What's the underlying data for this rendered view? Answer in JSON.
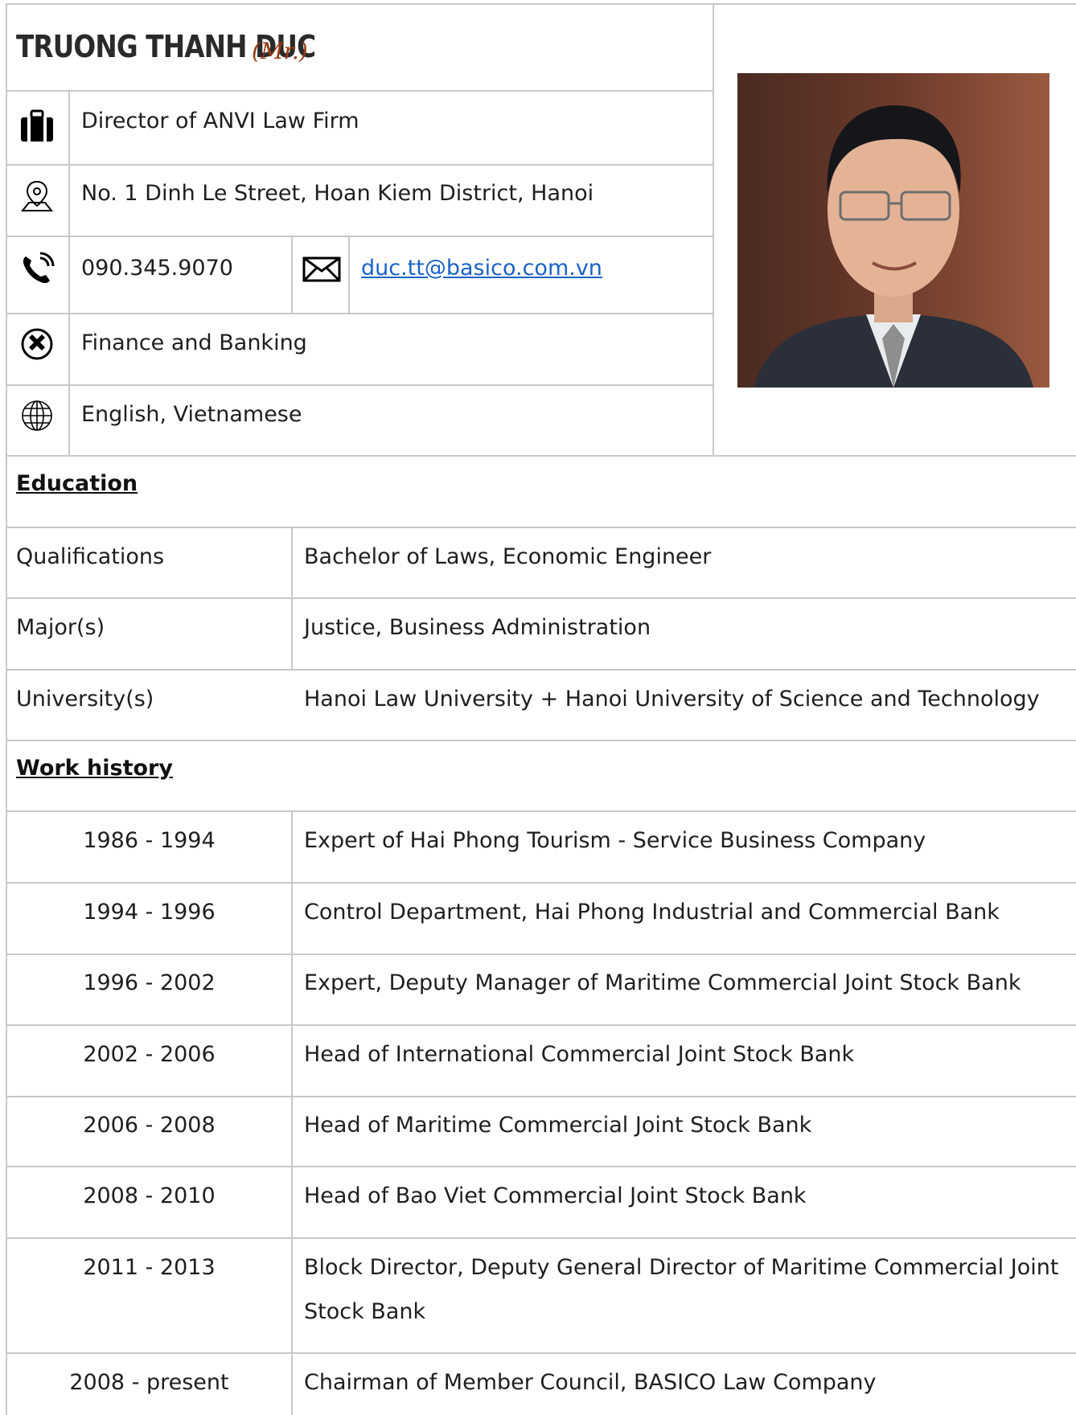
{
  "profile": {
    "name": "TRUONG THANH DUC",
    "title_suffix": "(Mr.)",
    "position": "Director of ANVI Law Firm",
    "address": "No. 1 Dinh Le Street, Hoan Kiem District, Hanoi",
    "phone": "090.345.9070",
    "email": "duc.tt@basico.com.vn",
    "field": "Finance and Banking",
    "languages": "English, Vietnamese",
    "icons": {
      "position": "briefcase-icon",
      "address": "location-pin-icon",
      "phone": "phone-icon",
      "email": "envelope-icon",
      "field": "expertise-icon",
      "languages": "globe-icon"
    }
  },
  "education": {
    "heading": "Education",
    "rows": [
      {
        "label": "Qualifications",
        "value": "Bachelor of Laws, Economic Engineer"
      },
      {
        "label": "Major(s)",
        "value": "Justice, Business Administration"
      },
      {
        "label": "University(s)",
        "value": "Hanoi Law University + Hanoi University of Science and Technology"
      }
    ]
  },
  "work": {
    "heading": "Work history",
    "rows": [
      {
        "period": "1986 - 1994",
        "role": "Expert of Hai Phong Tourism - Service Business Company"
      },
      {
        "period": "1994 - 1996",
        "role": "Control Department, Hai Phong Industrial and Commercial Bank"
      },
      {
        "period": "1996 - 2002",
        "role": "Expert, Deputy Manager of Maritime Commercial Joint Stock Bank"
      },
      {
        "period": "2002 - 2006",
        "role": "Head of International Commercial Joint Stock Bank"
      },
      {
        "period": "2006 - 2008",
        "role": "Head of Maritime Commercial Joint Stock Bank"
      },
      {
        "period": "2008 - 2010",
        "role": "Head of Bao Viet Commercial Joint Stock Bank"
      },
      {
        "period": "2011 - 2013",
        "role_line1": "Block Director, Deputy General Director of Maritime Commercial Joint",
        "role_line2": "Stock Bank"
      },
      {
        "period": "2008 - present",
        "role": "Chairman of Member Council, BASICO Law Company"
      }
    ]
  },
  "colors": {
    "border": "#c8c8c8",
    "title_suffix": "#9a3a14",
    "link": "#1a63c7"
  }
}
